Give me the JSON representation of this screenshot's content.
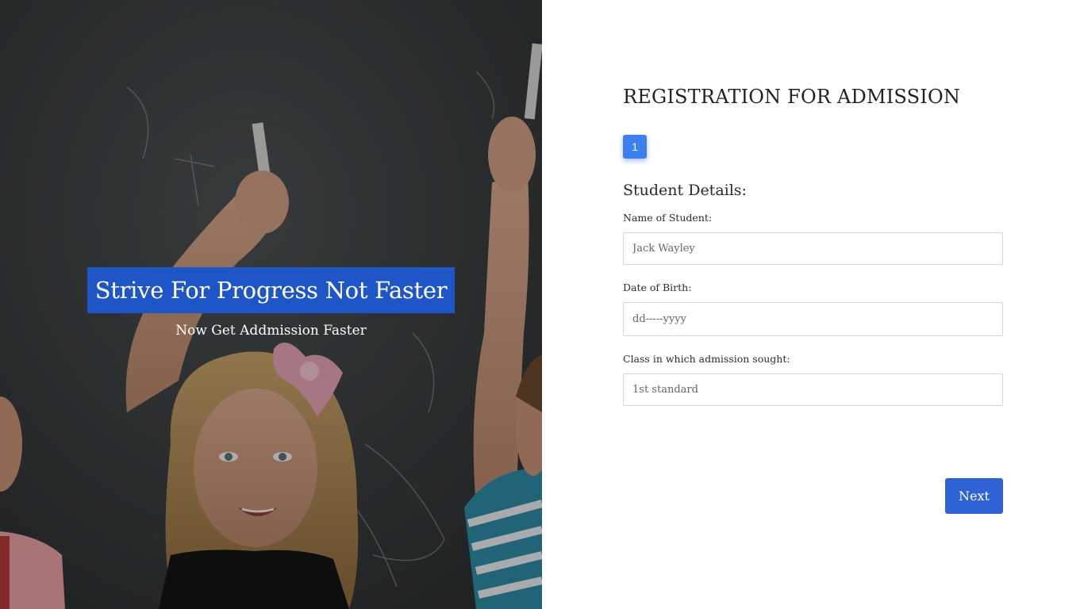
{
  "hero": {
    "title": "Strive For Progress Not Faster",
    "subtitle": "Now Get Addmission Faster",
    "image_description_icon": "kids-at-chalkboard-photo"
  },
  "form": {
    "heading": "REGISTRATION FOR ADMISSION",
    "step_number": "1",
    "section_title": "Student Details:",
    "fields": [
      {
        "label": "Name of Student:",
        "value": "",
        "placeholder": "Jack Wayley"
      },
      {
        "label": "Date of Birth:",
        "value": "",
        "placeholder": "dd-----yyyy"
      },
      {
        "label": "Class in which admission sought:",
        "value": "",
        "placeholder": "1st standard"
      }
    ],
    "next_label": "Next"
  },
  "colors": {
    "hero_title_bg": "#1e56c8",
    "step_badge": "#3b7ff2",
    "next_button": "#2f63d5"
  }
}
